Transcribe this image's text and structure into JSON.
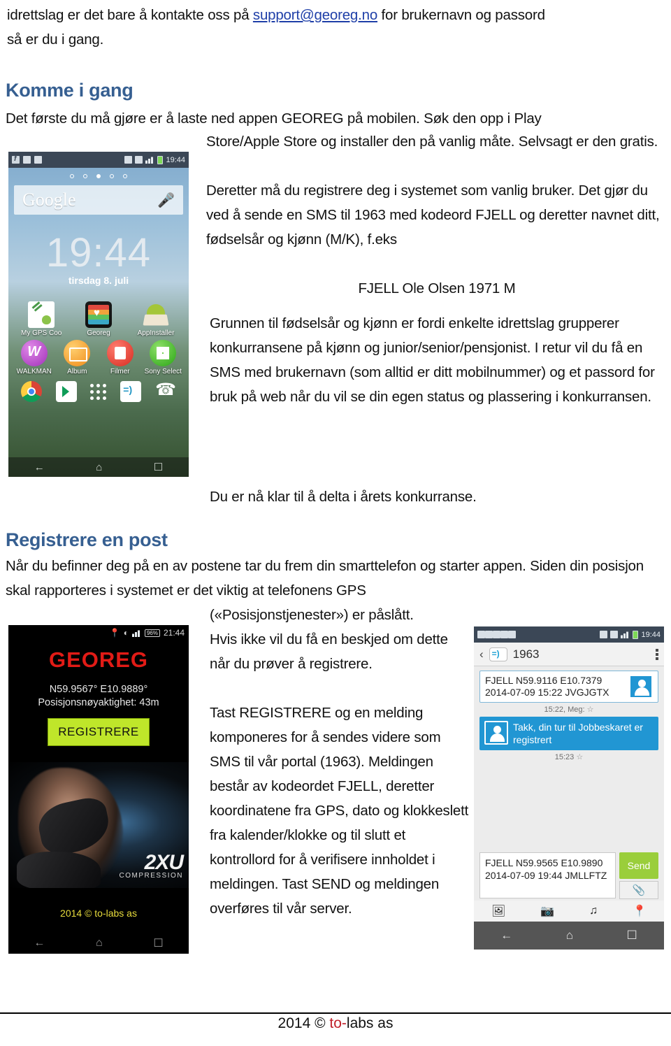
{
  "intro": {
    "line1_a": "idrettslag er det bare å kontakte oss på ",
    "link": "support@georeg.no",
    "line1_b": " for brukernavn og passord",
    "line2": "så er du i gang."
  },
  "section1": {
    "heading": "Komme i gang",
    "lead": "Det første du må gjøre er å laste ned appen GEOREG på mobilen. Søk den opp i Play",
    "p1": "Store/Apple Store og installer den på vanlig måte. Selvsagt er den gratis.",
    "p2": "Deretter må du registrere deg i systemet som vanlig bruker. Det gjør du ved å sende en SMS til 1963 med kodeord FJELL og deretter navnet ditt, fødselsår og kjønn (M/K), f.eks",
    "example": "FJELL Ole Olsen 1971 M",
    "p3": "Grunnen til fødselsår og kjønn er fordi enkelte idrettslag grupperer konkurransene på kjønn og junior/senior/pensjonist. I retur vil du få en SMS med brukernavn (som alltid er ditt mobilnummer) og et passord for bruk på web når du vil se din egen status og plassering i konkurransen.",
    "p4": "Du er nå klar til å delta i årets konkurranse."
  },
  "section2": {
    "heading": "Registrere en post",
    "lead1": "Når du befinner deg på en av postene tar du frem din smarttelefon og starter appen.",
    "lead2": "Siden din posisjon skal rapporteres i systemet er det viktig at telefonens GPS",
    "indent": "(«Posisjonstjenester») er påslått.",
    "p1": "Hvis ikke vil du få en beskjed om dette når du prøver å registrere.",
    "p2": "Tast REGISTRERE og en melding komponeres for å sendes videre som SMS til vår portal (1963). Meldingen består av kodeordet FJELL, deretter koordinatene fra GPS, dato og klokkeslett fra kalender/klokke og til slutt et kontrollord for å verifisere innholdet i meldingen. Tast SEND og meldingen overføres til vår server."
  },
  "footer": {
    "year": "2014 © ",
    "brand_red": "to-",
    "brand_rest": "labs as"
  },
  "phone_home": {
    "status_time": "19:44",
    "search_placeholder": "Google",
    "clock_time": "19:44",
    "clock_date": "tirsdag 8. juli",
    "apps_row1": [
      {
        "label": "My GPS Coo",
        "icon": "gps-coordinates-icon"
      },
      {
        "label": "Georeg",
        "icon": "georeg-app-icon"
      },
      {
        "label": "AppInstaller",
        "icon": "appinstaller-icon"
      }
    ],
    "apps_row2": [
      {
        "label": "WALKMAN",
        "icon": "walkman-icon"
      },
      {
        "label": "Album",
        "icon": "album-icon"
      },
      {
        "label": "Filmer",
        "icon": "filmer-icon"
      },
      {
        "label": "Sony Select",
        "icon": "sony-select-icon"
      }
    ],
    "dock": [
      "chrome-icon",
      "play-store-icon",
      "app-drawer-icon",
      "messaging-icon",
      "phone-icon"
    ],
    "nav": [
      "back-icon",
      "home-icon",
      "recents-icon"
    ]
  },
  "phone_georeg": {
    "status_battery": "96%",
    "status_time": "21:44",
    "app_title": "GEOREG",
    "coordinates": "N59.9567° E10.9889°",
    "accuracy": "Posisjonsnøyaktighet: 43m",
    "register_button": "REGISTRERE",
    "ad_brand": "2XU",
    "ad_tagline": "COMPRESSION",
    "copyright": "2014 © to-labs as"
  },
  "phone_sms": {
    "status_time": "19:44",
    "thread_number": "1963",
    "message_sent": "FJELL N59.9116 E10.7379 2014-07-09 15:22 JVGJGTX",
    "sent_stamp": "15:22, Meg:",
    "message_received": "Takk, din tur til Jobbeskaret er registrert",
    "received_stamp": "15:23",
    "compose_value": "FJELL N59.9565 E10.9890 2014-07-09 19:44 JMLLFTZ",
    "send_label": "Send",
    "tools": [
      "image-icon",
      "camera-icon",
      "audio-icon",
      "location-icon"
    ],
    "nav": [
      "back-icon",
      "home-icon",
      "recents-icon"
    ]
  }
}
